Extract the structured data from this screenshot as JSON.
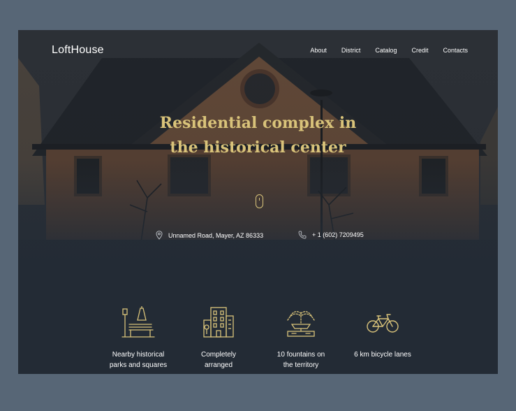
{
  "brand": "LoftHouse",
  "nav": [
    "About",
    "District",
    "Catalog",
    "Credit",
    "Contacts"
  ],
  "hero": {
    "title_line1": "Residential complex in",
    "title_line2": "the historical center",
    "address": "Unnamed Road, Mayer, AZ 86333",
    "phone": "+ 1 (602) 7209495"
  },
  "features": [
    {
      "icon": "park-bench-icon",
      "label": "Nearby historical\nparks and squares"
    },
    {
      "icon": "building-icon",
      "label": "Completely\narranged"
    },
    {
      "icon": "fountain-icon",
      "label": "10 fountains on\nthe territory"
    },
    {
      "icon": "bicycle-icon",
      "label": "6 km bicycle lanes"
    }
  ],
  "colors": {
    "background": "#576676",
    "site_bg": "#232b35",
    "accent": "#d9c37a",
    "text": "#ffffff"
  }
}
